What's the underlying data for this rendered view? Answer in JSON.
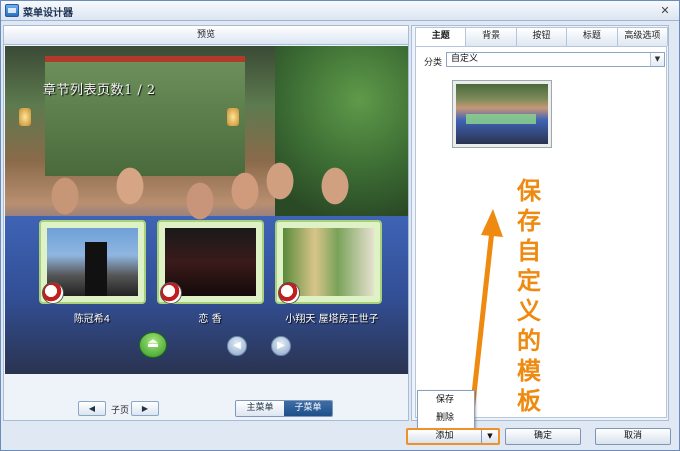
{
  "window": {
    "title": "菜单设计器",
    "close_glyph": "✕"
  },
  "preview": {
    "header": "预览",
    "canvas_title": "章节列表页数1 / 2",
    "thumbnails": [
      {
        "label": "陈冠希4"
      },
      {
        "label": "恋 香"
      },
      {
        "label": "小翔天 屋塔房王世子"
      }
    ],
    "nav_up_glyph": "⏏",
    "nav_prev_glyph": "◀",
    "nav_next_glyph": "▶"
  },
  "sub_nav": {
    "prev_glyph": "◀",
    "next_glyph": "▶",
    "page_label": "子页",
    "main_menu": "主菜单",
    "sub_menu": "子菜单"
  },
  "tabs": [
    "主题",
    "背景",
    "按钮",
    "标题",
    "高级选项"
  ],
  "theme": {
    "category_label": "分类",
    "category_value": "自定义",
    "dropdown_glyph": "▼"
  },
  "annotation": {
    "text": "保存自定义的模板"
  },
  "popup": {
    "items": [
      "保存",
      "删除"
    ]
  },
  "footer": {
    "add": "添加",
    "add_drop_glyph": "▼",
    "ok": "确定",
    "cancel": "取消"
  },
  "colors": {
    "accent": "#1f4f8a",
    "annotation": "#ef8a10",
    "frame": "#6a8cb8"
  }
}
